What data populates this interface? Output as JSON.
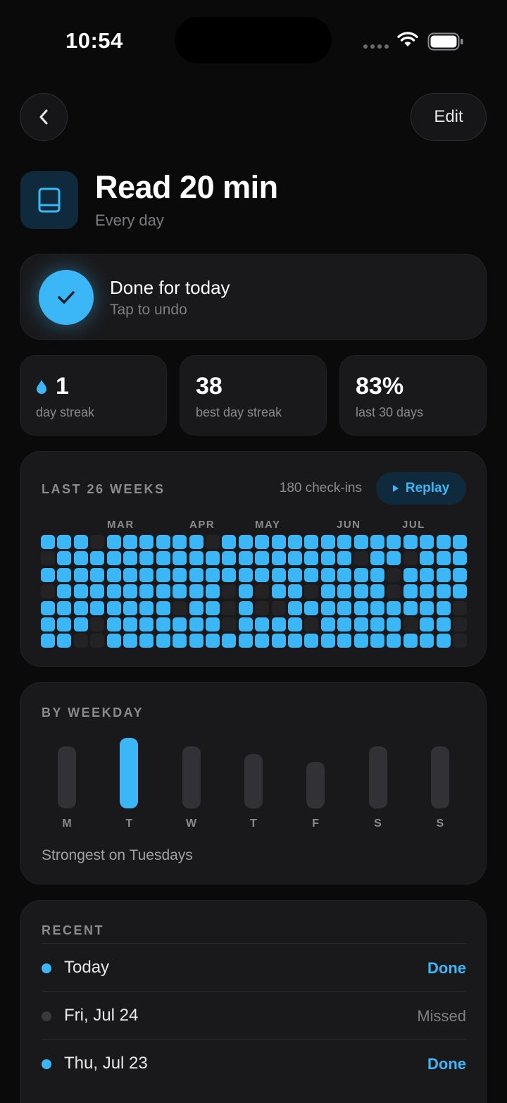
{
  "status": {
    "time": "10:54"
  },
  "header": {
    "edit_label": "Edit"
  },
  "habit": {
    "title": "Read 20 min",
    "frequency": "Every day",
    "icon": "book-icon"
  },
  "today": {
    "title": "Done for today",
    "subtitle": "Tap to undo",
    "checked": true
  },
  "stats": [
    {
      "value": "1",
      "label": "day streak",
      "icon": "flame-icon"
    },
    {
      "value": "38",
      "label": "best day streak"
    },
    {
      "value": "83%",
      "label": "last 30 days"
    }
  ],
  "history": {
    "label": "LAST 26 WEEKS",
    "checkins": "180 check-ins",
    "replay_label": "Replay",
    "months": [
      "MAR",
      "APR",
      "MAY",
      "JUN",
      "JUL"
    ],
    "accent": "#3bb7f7",
    "weeks": [
      "1010111",
      "1111111",
      "1111110",
      "0111100",
      "1111111",
      "1111111",
      "1111111",
      "1111111",
      "1111011",
      "1111111",
      "0111111",
      "1110001",
      "1111111",
      "1110011",
      "1111011",
      "1111111",
      "1110101",
      "1111111",
      "1111111",
      "1011111",
      "1111111",
      "1100111",
      "1011101",
      "1111111",
      "1111111",
      "1111000"
    ]
  },
  "weekday": {
    "label": "BY WEEKDAY",
    "days": [
      {
        "letter": "M",
        "value": 0.88,
        "best": false
      },
      {
        "letter": "T",
        "value": 1.0,
        "best": true
      },
      {
        "letter": "W",
        "value": 0.88,
        "best": false
      },
      {
        "letter": "T",
        "value": 0.77,
        "best": false
      },
      {
        "letter": "F",
        "value": 0.66,
        "best": false
      },
      {
        "letter": "S",
        "value": 0.88,
        "best": false
      },
      {
        "letter": "S",
        "value": 0.88,
        "best": false
      }
    ],
    "note": "Strongest on Tuesdays"
  },
  "recent": {
    "label": "RECENT",
    "items": [
      {
        "date": "Today",
        "status": "Done",
        "done": true
      },
      {
        "date": "Fri, Jul 24",
        "status": "Missed",
        "done": false
      },
      {
        "date": "Thu, Jul 23",
        "status": "Done",
        "done": true
      }
    ]
  }
}
